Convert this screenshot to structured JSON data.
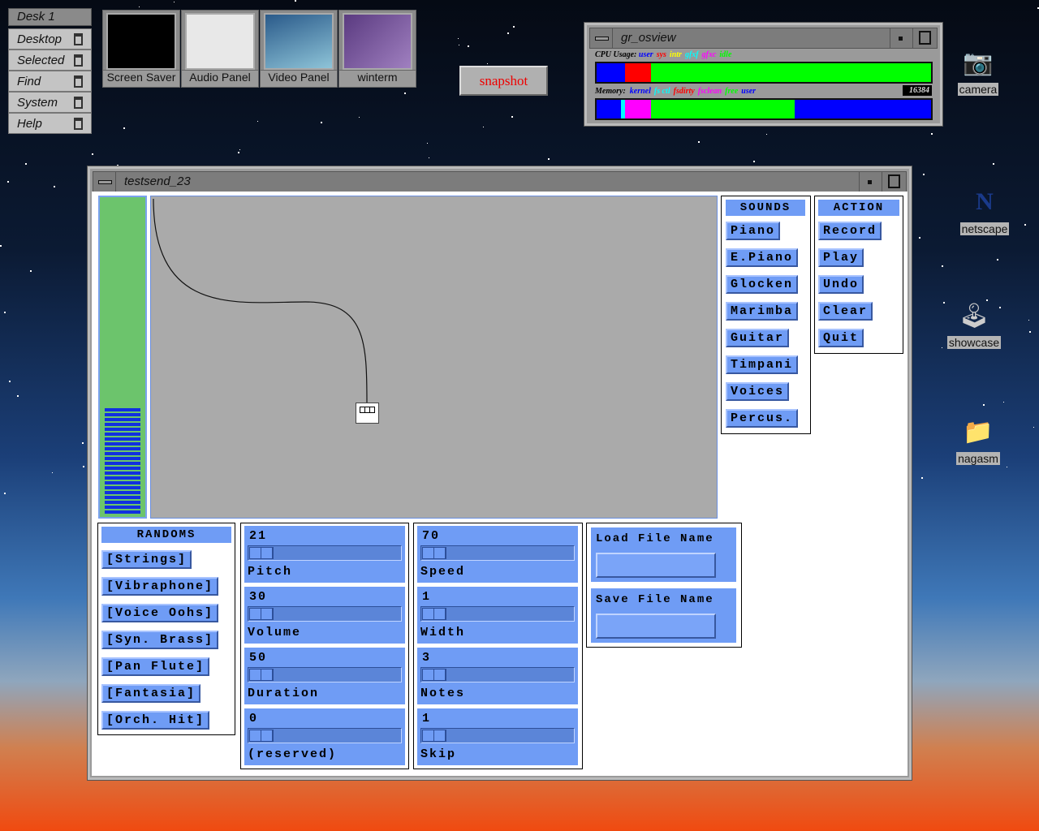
{
  "desk": {
    "title": "Desk 1",
    "menus": [
      "Desktop",
      "Selected",
      "Find",
      "System",
      "Help"
    ]
  },
  "launchers": [
    "Screen Saver",
    "Audio Panel",
    "Video Panel",
    "winterm"
  ],
  "snapshot": "snapshot",
  "osview": {
    "title": "gr_osview",
    "cpu_label": "CPU Usage:",
    "cpu_legend": [
      {
        "t": "user",
        "c": "#0000ff"
      },
      {
        "t": "sys",
        "c": "#ff0000"
      },
      {
        "t": "intr",
        "c": "#ffff00"
      },
      {
        "t": "gfxf",
        "c": "#00ffff"
      },
      {
        "t": "gfxc",
        "c": "#ff00ff"
      },
      {
        "t": "idle",
        "c": "#00ff00"
      }
    ],
    "cpu": [
      {
        "c": "#0000ff",
        "p": 8.4
      },
      {
        "c": "#ff0000",
        "p": 7.9
      },
      {
        "c": "#00ff00",
        "p": 83.7
      }
    ],
    "mem_label": "Memory:",
    "mem_legend": [
      {
        "t": "kernel",
        "c": "#0000ff"
      },
      {
        "t": "fs ctl",
        "c": "#00ffff"
      },
      {
        "t": "fsdirty",
        "c": "#ff0000"
      },
      {
        "t": "fsclean",
        "c": "#ff00ff"
      },
      {
        "t": "free",
        "c": "#00ff00"
      },
      {
        "t": "user",
        "c": "#0000ff"
      }
    ],
    "mem": [
      {
        "c": "#0000ff",
        "p": 7.3
      },
      {
        "c": "#00ffff",
        "p": 1.2
      },
      {
        "c": "#ff00ff",
        "p": 7.8
      },
      {
        "c": "#00ff00",
        "p": 42.9
      },
      {
        "c": "#0000ff",
        "p": 40.8
      }
    ],
    "mem_total": "16384"
  },
  "desktop_icons": [
    "camera",
    "netscape",
    "showcase",
    "nagasm"
  ],
  "app": {
    "title": "testsend_23",
    "level_meter_bars": 22,
    "sounds": {
      "header": "SOUNDS",
      "items": [
        "Piano",
        "E.Piano",
        "Glocken",
        "Marimba",
        "Guitar",
        "Timpani",
        "Voices",
        "Percus."
      ]
    },
    "action": {
      "header": "ACTION",
      "items": [
        "Record",
        "Play",
        "Undo",
        "Clear",
        "Quit"
      ]
    },
    "randoms": {
      "header": "RANDOMS",
      "items": [
        "[Strings]",
        "[Vibraphone]",
        "[Voice Oohs]",
        "[Syn. Brass]",
        "[Pan Flute]",
        "[Fantasia]",
        "[Orch. Hit]"
      ]
    },
    "sliders_left": [
      {
        "value": "21",
        "label": "Pitch"
      },
      {
        "value": "30",
        "label": "Volume"
      },
      {
        "value": "50",
        "label": "Duration"
      },
      {
        "value": "0",
        "label": "(reserved)"
      }
    ],
    "sliders_right": [
      {
        "value": "70",
        "label": "Speed"
      },
      {
        "value": "1",
        "label": "Width"
      },
      {
        "value": "3",
        "label": "Notes"
      },
      {
        "value": "1",
        "label": "Skip"
      }
    ],
    "load_label": "Load File Name",
    "load_value": "",
    "save_label": "Save File Name",
    "save_value": ""
  }
}
